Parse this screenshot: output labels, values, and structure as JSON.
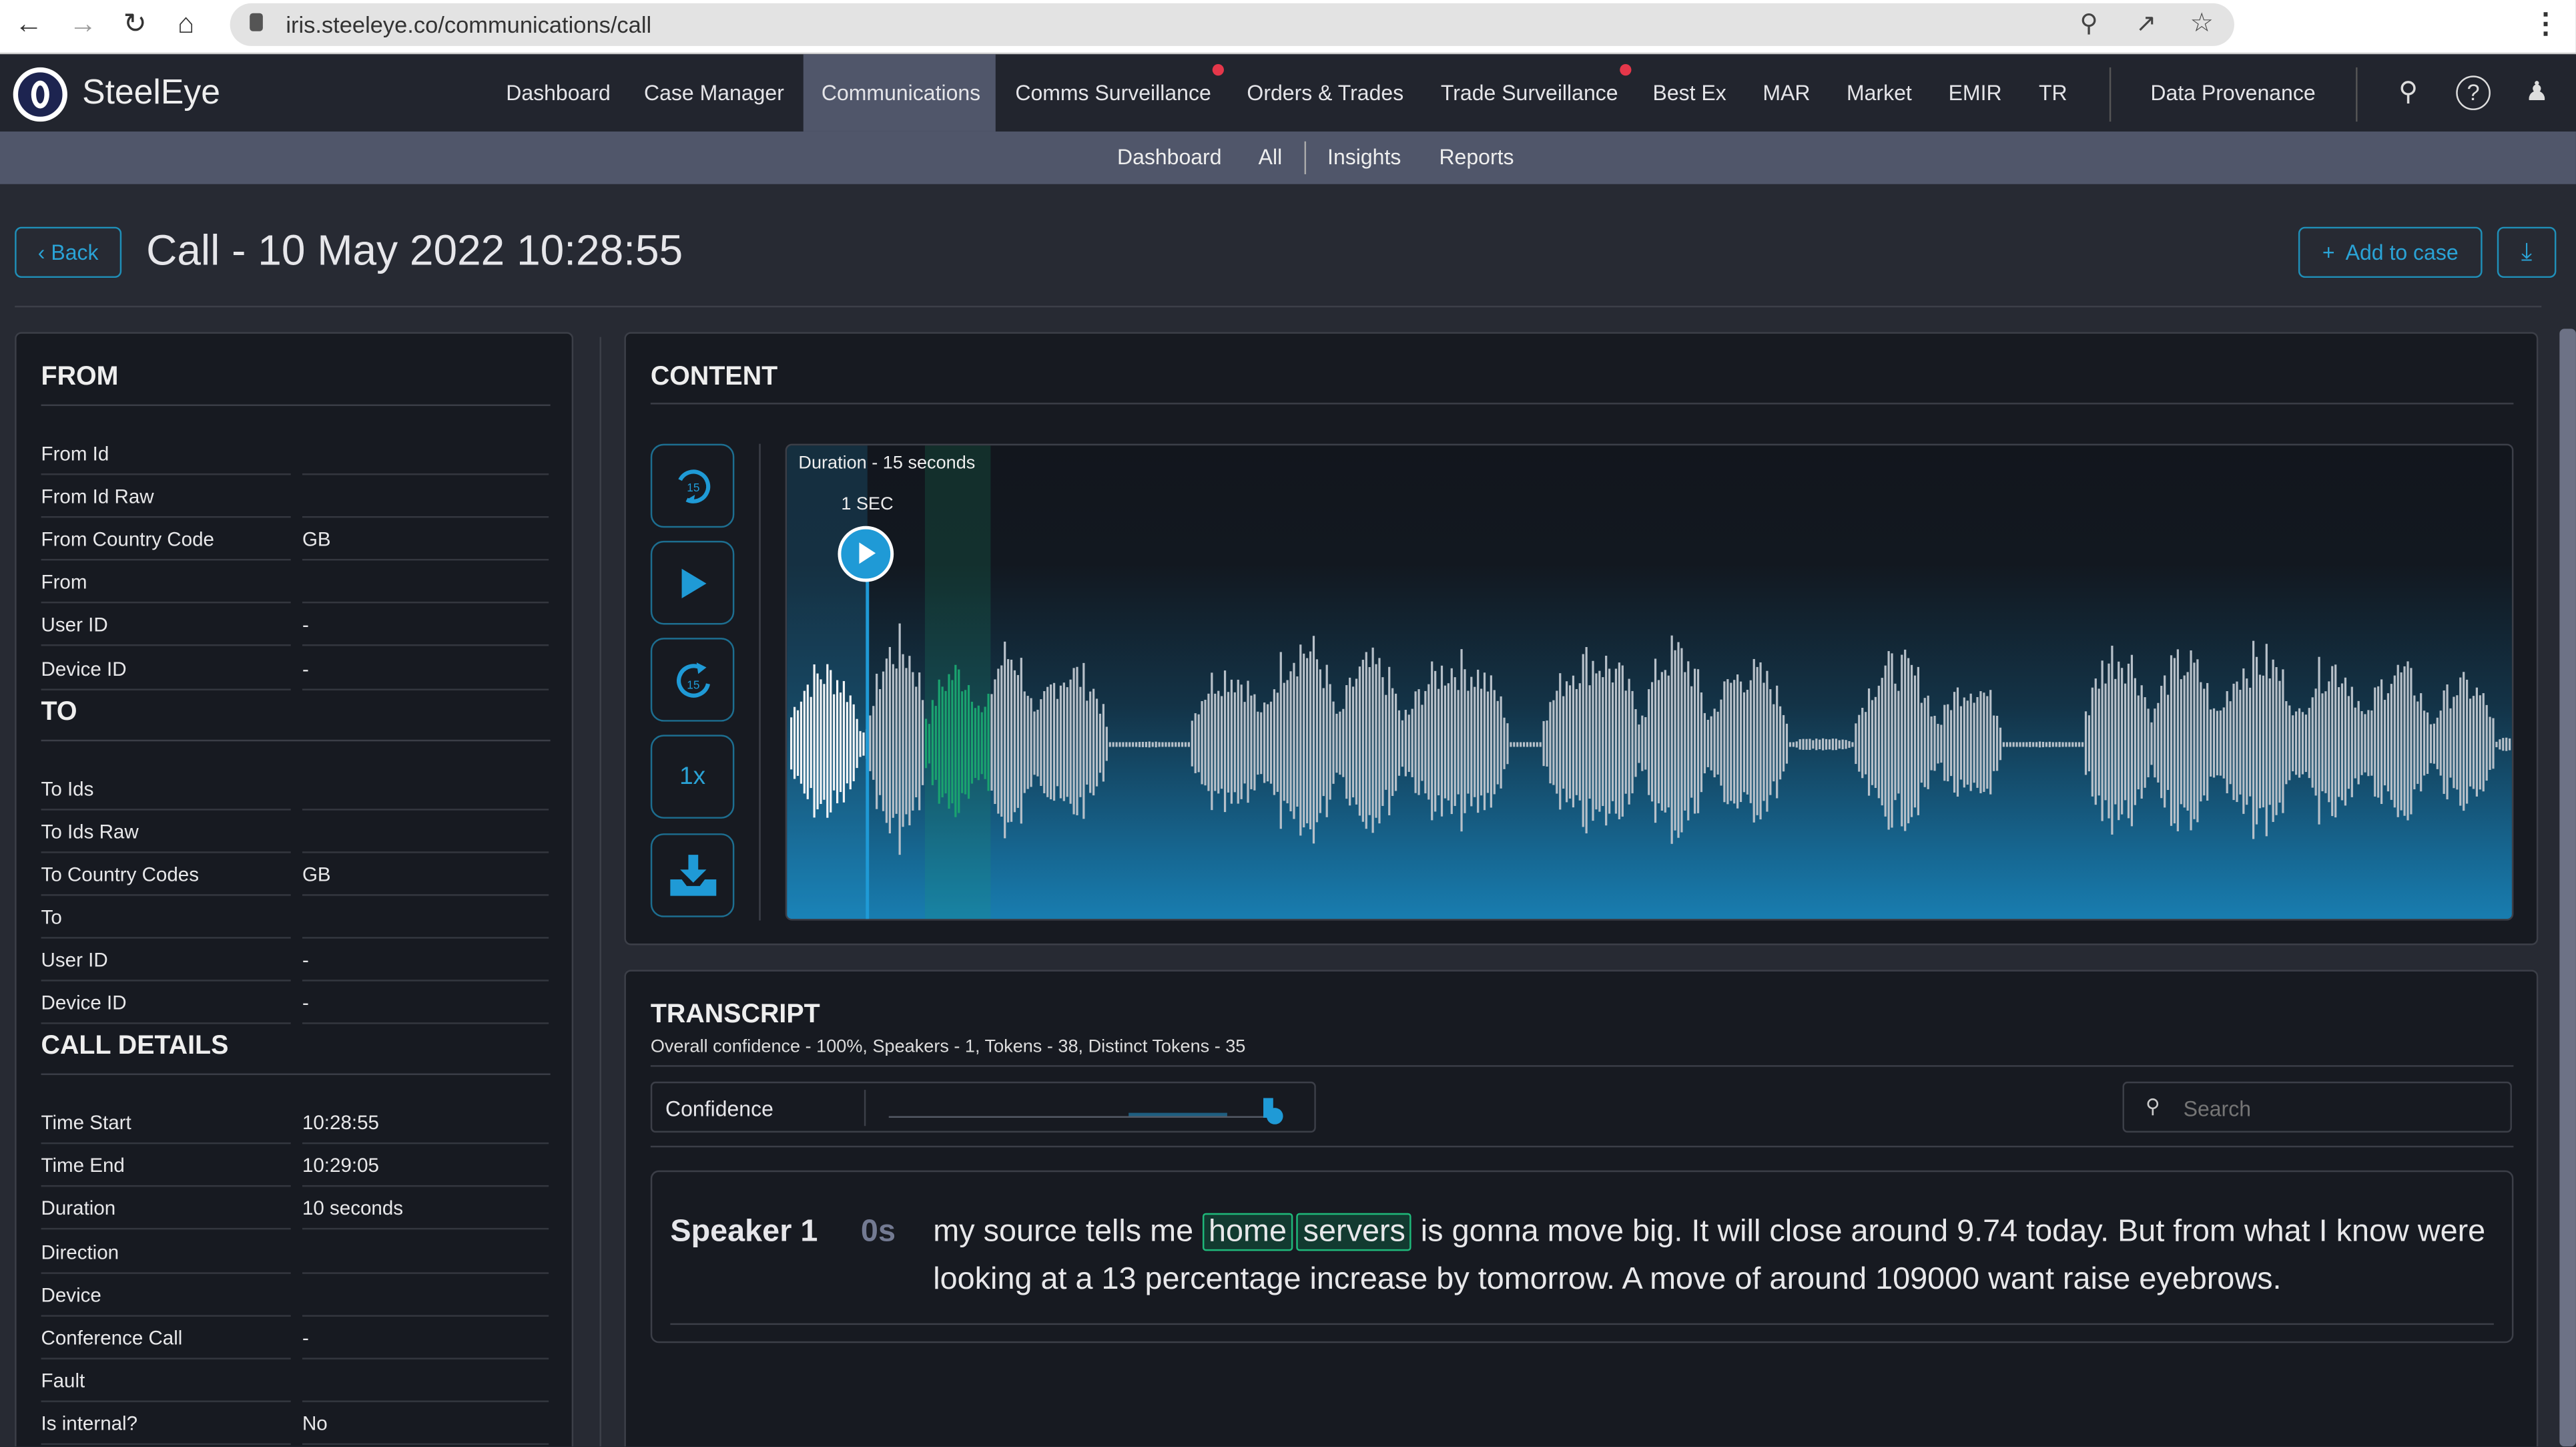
{
  "browser": {
    "url": "iris.steeleye.co/communications/call",
    "icons": [
      "back-arrow",
      "forward-arrow",
      "reload",
      "home",
      "lock",
      "zoom-out",
      "share",
      "star",
      "kebab-menu"
    ]
  },
  "app": {
    "logo_text": "SteelEye"
  },
  "nav": {
    "items": [
      {
        "label": "Dashboard"
      },
      {
        "label": "Case Manager"
      },
      {
        "label": "Communications",
        "active": true
      },
      {
        "label": "Comms Surveillance",
        "badge": true
      },
      {
        "label": "Orders & Trades"
      },
      {
        "label": "Trade Surveillance",
        "badge": true
      },
      {
        "label": "Best Ex"
      },
      {
        "label": "MAR"
      },
      {
        "label": "Market"
      },
      {
        "label": "EMIR"
      },
      {
        "label": "TR"
      },
      {
        "label": "Data Provenance"
      }
    ],
    "icons": [
      "key",
      "help",
      "user"
    ]
  },
  "subnav": {
    "items": [
      "Dashboard",
      "All",
      "Insights",
      "Reports"
    ]
  },
  "header": {
    "back_label": "Back",
    "title": "Call - 10 May 2022 10:28:55",
    "add_to_case_label": "Add to case"
  },
  "details": {
    "from": {
      "title": "FROM",
      "rows": [
        [
          "From Id",
          ""
        ],
        [
          "From Id Raw",
          ""
        ],
        [
          "From Country Code",
          "GB"
        ],
        [
          "From",
          ""
        ],
        [
          "User ID",
          "-"
        ],
        [
          "Device ID",
          "-"
        ]
      ]
    },
    "to": {
      "title": "TO",
      "rows": [
        [
          "To Ids",
          ""
        ],
        [
          "To Ids Raw",
          ""
        ],
        [
          "To Country Codes",
          "GB"
        ],
        [
          "To",
          ""
        ],
        [
          "User ID",
          "-"
        ],
        [
          "Device ID",
          "-"
        ]
      ]
    },
    "call": {
      "title": "CALL DETAILS",
      "rows": [
        [
          "Time Start",
          "10:28:55"
        ],
        [
          "Time End",
          "10:29:05"
        ],
        [
          "Duration",
          "10 seconds"
        ],
        [
          "Direction",
          ""
        ],
        [
          "Device",
          ""
        ],
        [
          "Conference Call",
          "-"
        ],
        [
          "Fault",
          ""
        ],
        [
          "Is internal?",
          "No"
        ]
      ]
    }
  },
  "content": {
    "title": "CONTENT",
    "duration_label": "Duration - 15 seconds",
    "playhead_label": "1 SEC",
    "speed_label": "1x",
    "rewind_label": "15",
    "forward_label": "15",
    "accent": "#1f9ad6",
    "highlight": "#1aa36f"
  },
  "transcript": {
    "title": "TRANSCRIPT",
    "summary": "Overall confidence - 100%, Speakers - 1, Tokens - 38, Distinct Tokens - 35",
    "confidence_label": "Confidence",
    "confidence_value": 1.0,
    "search_placeholder": "Search",
    "segments": [
      {
        "speaker": "Speaker 1",
        "time": "0s",
        "pre": "my source tells me",
        "kw1": "home",
        "kw2": "servers",
        "post": "is gonna move big. It will close around 9.74 today. But from what I know were looking at a 13 percentage increase by tomorrow. A move of around 109000 want raise eyebrows."
      }
    ]
  }
}
